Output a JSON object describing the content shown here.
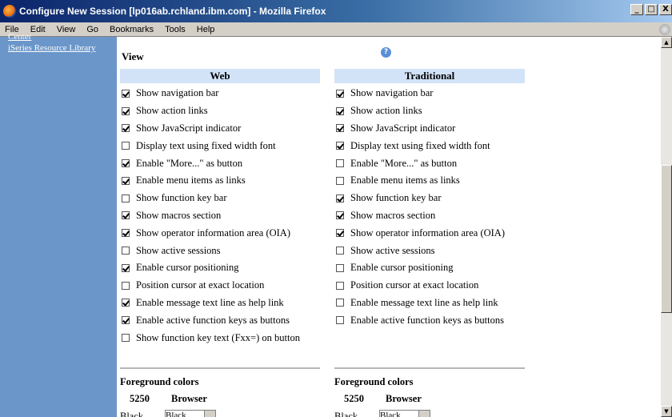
{
  "window": {
    "title": "Configure New Session [lp016ab.rchland.ibm.com] - Mozilla Firefox",
    "controls": {
      "minimize": "_",
      "maximize": "□",
      "close": "X"
    }
  },
  "menubar": [
    {
      "label": "File"
    },
    {
      "label": "Edit"
    },
    {
      "label": "View"
    },
    {
      "label": "Go"
    },
    {
      "label": "Bookmarks"
    },
    {
      "label": "Tools"
    },
    {
      "label": "Help"
    }
  ],
  "sidebar": {
    "cut_link": "Center",
    "library_link": "iSeries Resource Library"
  },
  "view": {
    "heading": "View",
    "help_icon": "?",
    "web": {
      "heading": "Web",
      "options": [
        {
          "label": "Show navigation bar",
          "checked": true
        },
        {
          "label": "Show action links",
          "checked": true
        },
        {
          "label": "Show JavaScript indicator",
          "checked": true
        },
        {
          "label": "Display text using fixed width font",
          "checked": false
        },
        {
          "label": "Enable \"More...\" as button",
          "checked": true
        },
        {
          "label": "Enable menu items as links",
          "checked": true
        },
        {
          "label": "Show function key bar",
          "checked": false
        },
        {
          "label": "Show macros section",
          "checked": true
        },
        {
          "label": "Show operator information area (OIA)",
          "checked": true
        },
        {
          "label": "Show active sessions",
          "checked": false
        },
        {
          "label": "Enable cursor positioning",
          "checked": true
        },
        {
          "label": "Position cursor at exact location",
          "checked": false
        },
        {
          "label": "Enable message text line as help link",
          "checked": true
        },
        {
          "label": "Enable active function keys as buttons",
          "checked": true
        },
        {
          "label": "Show function key text (Fxx=) on button",
          "checked": false
        }
      ]
    },
    "traditional": {
      "heading": "Traditional",
      "options": [
        {
          "label": "Show navigation bar",
          "checked": true
        },
        {
          "label": "Show action links",
          "checked": true
        },
        {
          "label": "Show JavaScript indicator",
          "checked": true
        },
        {
          "label": "Display text using fixed width font",
          "checked": true
        },
        {
          "label": "Enable \"More...\" as button",
          "checked": false
        },
        {
          "label": "Enable menu items as links",
          "checked": false
        },
        {
          "label": "Show function key bar",
          "checked": true
        },
        {
          "label": "Show macros section",
          "checked": true
        },
        {
          "label": "Show operator information area (OIA)",
          "checked": true
        },
        {
          "label": "Show active sessions",
          "checked": false
        },
        {
          "label": "Enable cursor positioning",
          "checked": false
        },
        {
          "label": "Position cursor at exact location",
          "checked": false
        },
        {
          "label": "Enable message text line as help link",
          "checked": false
        },
        {
          "label": "Enable active function keys as buttons",
          "checked": false
        }
      ]
    }
  },
  "foreground": {
    "web": {
      "heading": "Foreground colors",
      "col_5250": "5250",
      "col_browser": "Browser",
      "row_label": "Black",
      "select_value": "Black"
    },
    "traditional": {
      "heading": "Foreground colors",
      "col_5250": "5250",
      "col_browser": "Browser",
      "row_label": "Black",
      "select_value": "Black"
    }
  }
}
